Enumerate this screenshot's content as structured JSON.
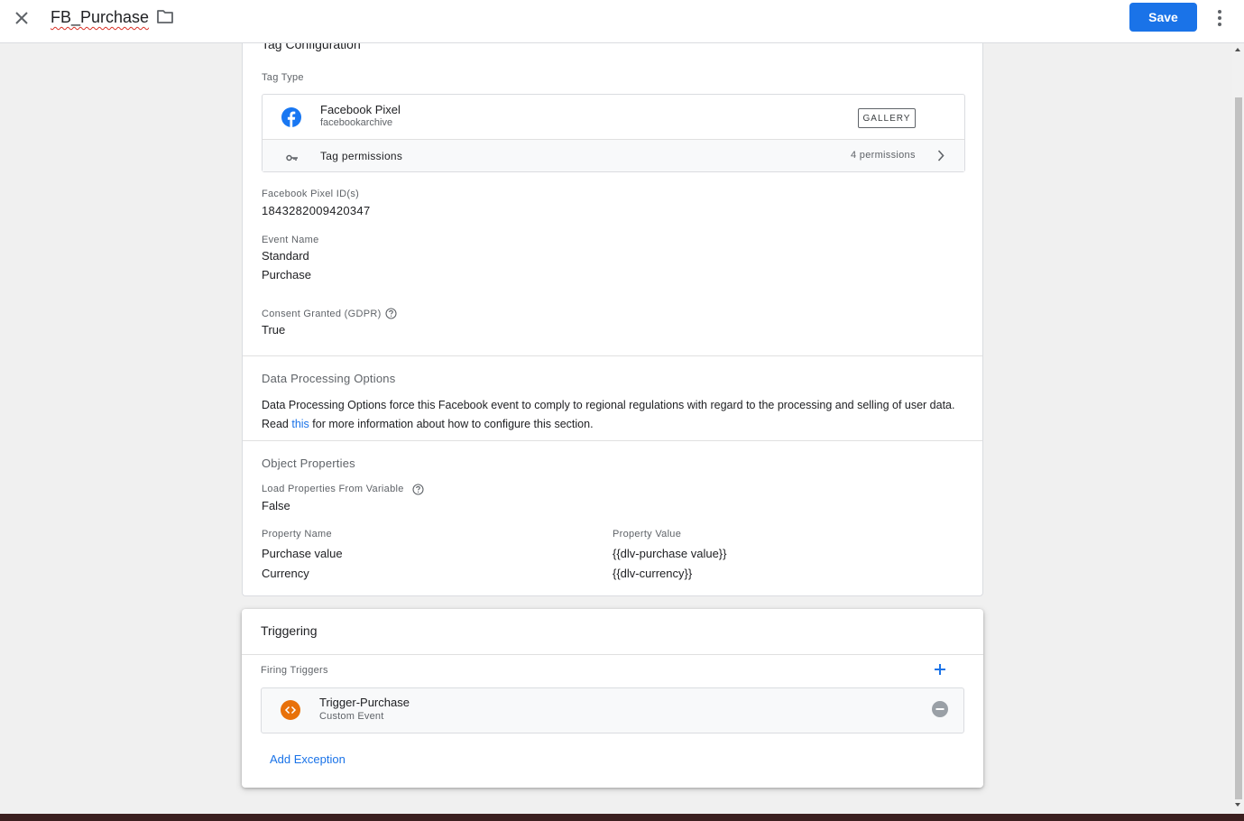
{
  "header": {
    "tag_name": "FB_Purchase",
    "save_label": "Save"
  },
  "config": {
    "section_title": "Tag Configuration",
    "tag_type_label": "Tag Type",
    "tag_type_name": "Facebook Pixel",
    "tag_type_vendor": "facebookarchive",
    "gallery_label": "GALLERY",
    "permissions_label": "Tag permissions",
    "permissions_count": "4 permissions",
    "pixel_id_label": "Facebook Pixel ID(s)",
    "pixel_id_value": "1843282009420347",
    "event_name_label": "Event Name",
    "event_name_type": "Standard",
    "event_name_value": "Purchase",
    "consent_label": "Consent Granted (GDPR)",
    "consent_value": "True",
    "dpo_title": "Data Processing Options",
    "dpo_text_before": "Data Processing Options force this Facebook event to comply to regional regulations with regard to the processing and selling of user data. Read ",
    "dpo_link": "this",
    "dpo_text_after": " for more information about how to configure this section.",
    "obj_title": "Object Properties",
    "load_props_label": "Load Properties From Variable",
    "load_props_value": "False",
    "prop_name_header": "Property Name",
    "prop_value_header": "Property Value",
    "properties": [
      {
        "name": "Purchase value",
        "value": "{{dlv-purchase value}}"
      },
      {
        "name": "Currency",
        "value": "{{dlv-currency}}"
      }
    ]
  },
  "triggering": {
    "title": "Triggering",
    "firing_label": "Firing Triggers",
    "trigger_name": "Trigger-Purchase",
    "trigger_type": "Custom Event",
    "add_exception": "Add Exception"
  },
  "colors": {
    "accent": "#1a73e8",
    "facebook": "#1877f2",
    "trigger_icon": "#e8710a"
  }
}
